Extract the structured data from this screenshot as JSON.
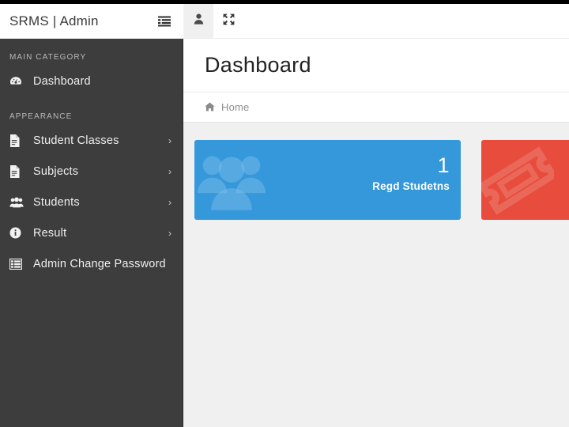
{
  "brand": {
    "title": "SRMS | Admin",
    "toggle_icon": "th-list-icon"
  },
  "topbar": {
    "buttons": [
      {
        "icon": "user-icon",
        "name": "user-menu-button",
        "active": true
      },
      {
        "icon": "expand-arrows-icon",
        "name": "fullscreen-button",
        "active": false
      }
    ]
  },
  "sidebar": {
    "sections": [
      {
        "heading": "MAIN CATEGORY",
        "items": [
          {
            "label": "Dashboard",
            "icon": "tachometer-icon",
            "caret": ""
          }
        ]
      },
      {
        "heading": "APPEARANCE",
        "items": [
          {
            "label": "Student Classes",
            "icon": "file-icon",
            "caret": "›"
          },
          {
            "label": "Subjects",
            "icon": "file-icon",
            "caret": "›"
          },
          {
            "label": "Students",
            "icon": "users-icon",
            "caret": "›"
          },
          {
            "label": "Result",
            "icon": "info-circle-icon",
            "caret": "›"
          },
          {
            "label": "Admin Change Password",
            "icon": "th-list-icon",
            "caret": ""
          }
        ]
      }
    ]
  },
  "page": {
    "title": "Dashboard",
    "breadcrumb": {
      "home_icon": "home-icon",
      "home_label": "Home"
    }
  },
  "cards": [
    {
      "value": "1",
      "label": "Regd Studetns",
      "color": "#3498db",
      "icon": "users-icon",
      "name": "card-regd-students"
    },
    {
      "value": "",
      "label": "",
      "color": "#e74c3c",
      "icon": "ticket-icon",
      "name": "card-secondary"
    }
  ],
  "colors": {
    "sidebar_bg": "#3d3d3d",
    "content_bg": "#f0f0f0",
    "panel_bg": "#ffffff",
    "accent_blue": "#3498db",
    "accent_red": "#e74c3c",
    "top_strip": "#000000"
  }
}
